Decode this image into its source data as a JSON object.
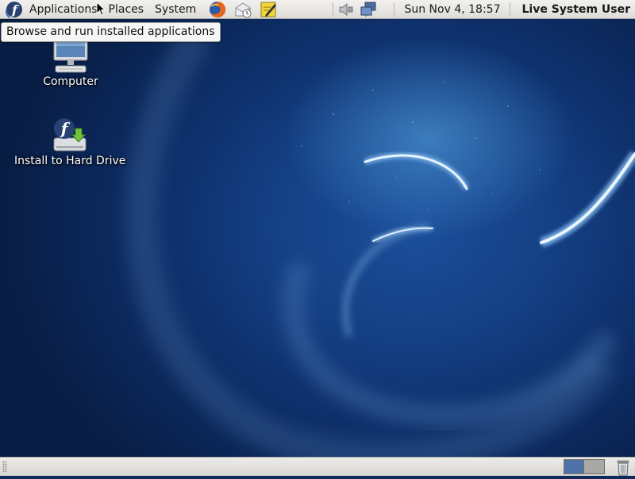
{
  "top_panel": {
    "menus": {
      "applications": "Applications",
      "places": "Places",
      "system": "System"
    },
    "launchers": [
      "fedora-logo-icon",
      "firefox-icon",
      "mail-clock-icon",
      "notes-editor-icon"
    ],
    "tray": [
      "volume-icon",
      "network-icon"
    ],
    "clock": "Sun Nov  4, 18:57",
    "user": "Live System User"
  },
  "tooltip": "Browse and run installed applications",
  "desktop": {
    "icons": [
      {
        "label": "Computer",
        "icon": "computer-icon"
      },
      {
        "label": "Install to Hard Drive",
        "icon": "install-hard-drive-icon"
      }
    ]
  },
  "bottom_panel": {
    "workspaces": 2,
    "active_workspace": 1,
    "trash_icon": "trash-icon"
  },
  "colors": {
    "panel_bg": "#e6e5e2",
    "wallpaper_dark": "#081d44",
    "wallpaper_mid": "#1c4f9b",
    "swirl_highlight": "#cfe9ff",
    "workspace_active": "#4f73a8",
    "workspace_inactive": "#a8a8a6"
  }
}
